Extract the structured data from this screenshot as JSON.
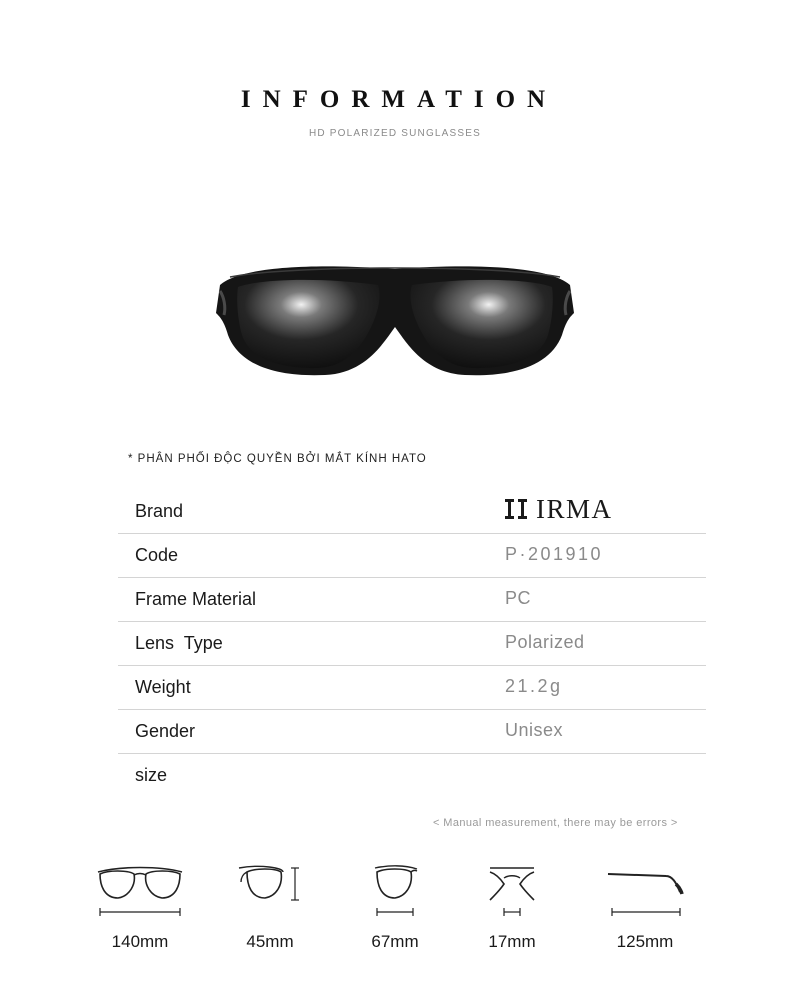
{
  "header": {
    "title": "INFORMATION",
    "subtitle": "HD POLARIZED SUNGLASSES"
  },
  "note": "* PHÂN PHỐI ĐỘC QUYỀN BỞI MẮT KÍNH HATO",
  "specs": {
    "brand": {
      "label": "Brand",
      "value": "IRMA"
    },
    "code": {
      "label": "Code",
      "value": "P·201910"
    },
    "frame": {
      "label": "Frame Material",
      "value": "PC"
    },
    "lens": {
      "label": "Lens  Type",
      "value": "Polarized"
    },
    "weight": {
      "label": "Weight",
      "value": "21.2g"
    },
    "gender": {
      "label": "Gender",
      "value": "Unisex"
    },
    "size": {
      "label": "size"
    }
  },
  "measurement_note": "< Manual measurement, there may be errors >",
  "dimensions": {
    "frame_width": "140mm",
    "lens_height": "45mm",
    "lens_width": "67mm",
    "bridge": "17mm",
    "temple": "125mm"
  }
}
